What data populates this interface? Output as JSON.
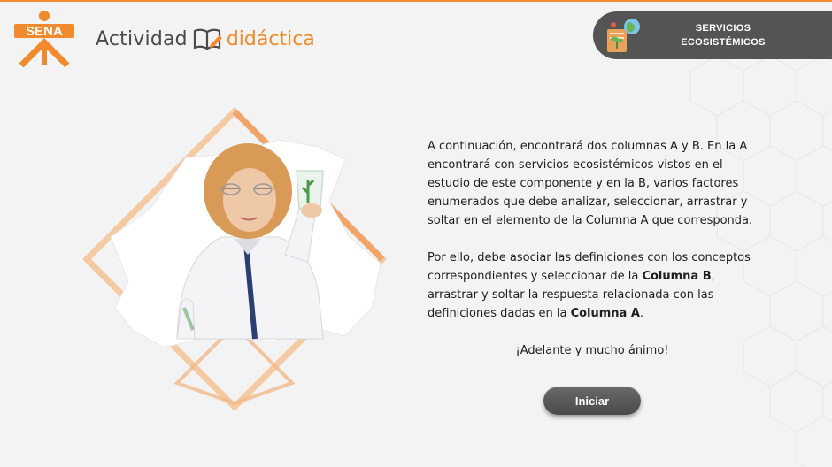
{
  "header": {
    "logo_text": "SENA",
    "title_part1": "Actividad",
    "title_part2": "didáctica",
    "module_line1": "SERVICIOS",
    "module_line2": "ECOSISTÉMICOS"
  },
  "content": {
    "paragraph1": "A continuación, encontrará dos columnas A y B. En la A encontrará con servicios ecosistémicos vistos en el estudio de este componente y en la B, varios factores enumerados que debe analizar, seleccionar, arrastrar y soltar en el elemento de la Columna A que corresponda.",
    "p2_a": "Por ello, debe asociar las definiciones con los conceptos correspondientes y seleccionar de la ",
    "p2_b": "Columna B",
    "p2_c": ", arrastrar y soltar la respuesta relacionada con las definiciones dadas en la ",
    "p2_d": "Columna A",
    "p2_e": ".",
    "closing": "¡Adelante y mucho ánimo!",
    "start_label": "Iniciar"
  },
  "colors": {
    "accent": "#f08a2c",
    "pill": "#545454",
    "button": "#555555",
    "background": "#f3f3f3"
  },
  "icons": [
    "sena-logo",
    "book-pencil-icon",
    "ecosystem-icon",
    "scientist-photo"
  ]
}
